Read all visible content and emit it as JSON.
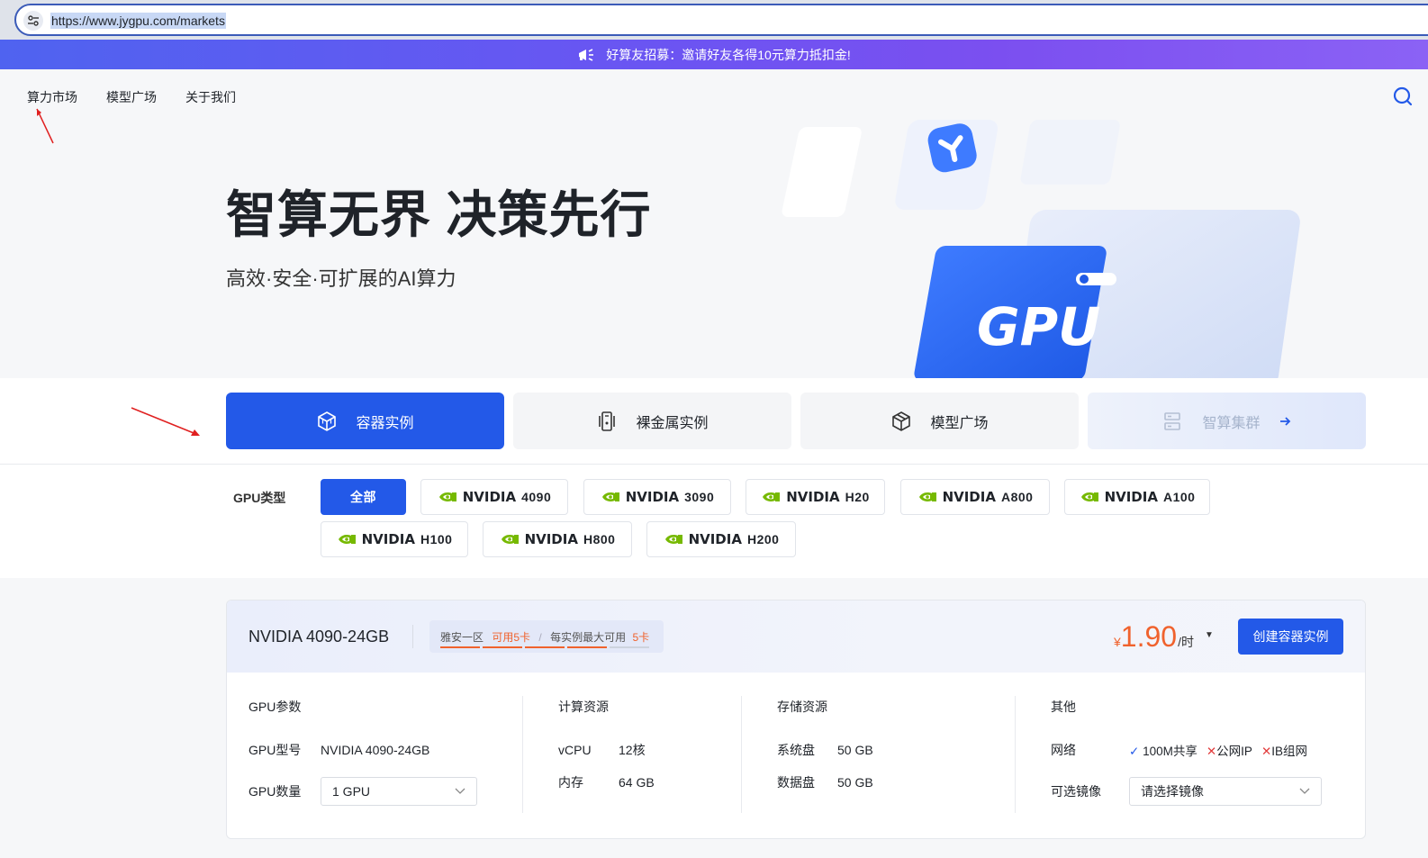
{
  "browser": {
    "url": "https://www.jygpu.com/markets"
  },
  "promo": {
    "text": "好算友招募：邀请好友各得10元算力抵扣金!"
  },
  "nav": {
    "items": [
      "算力市场",
      "模型广场",
      "关于我们"
    ]
  },
  "hero": {
    "title": "智算无界 决策先行",
    "subtitle": "高效·安全·可扩展的AI算力",
    "art_text": "GPU"
  },
  "tabs": [
    {
      "label": "容器实例",
      "icon": "cube-icon"
    },
    {
      "label": "裸金属实例",
      "icon": "server-icon"
    },
    {
      "label": "模型广场",
      "icon": "box-icon"
    },
    {
      "label": "智算集群",
      "icon": "cluster-icon"
    }
  ],
  "filter": {
    "label": "GPU类型",
    "all": "全部",
    "brand": "NVIDIA",
    "models": [
      "4090",
      "3090",
      "H20",
      "A800",
      "A100",
      "H100",
      "H800",
      "H200"
    ]
  },
  "card": {
    "title": "NVIDIA 4090-24GB",
    "zone": "雅安一区",
    "available": "可用5卡",
    "sep": "/",
    "max_label": "每实例最大可用",
    "max_value": "5卡",
    "price_currency": "¥",
    "price_value": "1.90",
    "price_unit": "/时",
    "create_button": "创建容器实例",
    "gpu": {
      "heading": "GPU参数",
      "model_label": "GPU型号",
      "model_value": "NVIDIA 4090-24GB",
      "count_label": "GPU数量",
      "count_value": "1 GPU"
    },
    "compute": {
      "heading": "计算资源",
      "vcpu_label": "vCPU",
      "vcpu_value": "12核",
      "mem_label": "内存",
      "mem_value": "64 GB"
    },
    "storage": {
      "heading": "存储资源",
      "sys_label": "系统盘",
      "sys_value": "50 GB",
      "data_label": "数据盘",
      "data_value": "50 GB"
    },
    "other": {
      "heading": "其他",
      "net_label": "网络",
      "net_ok": "100M共享",
      "net_no1": "公网IP",
      "net_no2": "IB组网",
      "image_label": "可选镜像",
      "image_placeholder": "请选择镜像"
    }
  },
  "colors": {
    "primary": "#2359e8",
    "accent": "#f0622d",
    "annotation_arrow": "#e02020"
  }
}
